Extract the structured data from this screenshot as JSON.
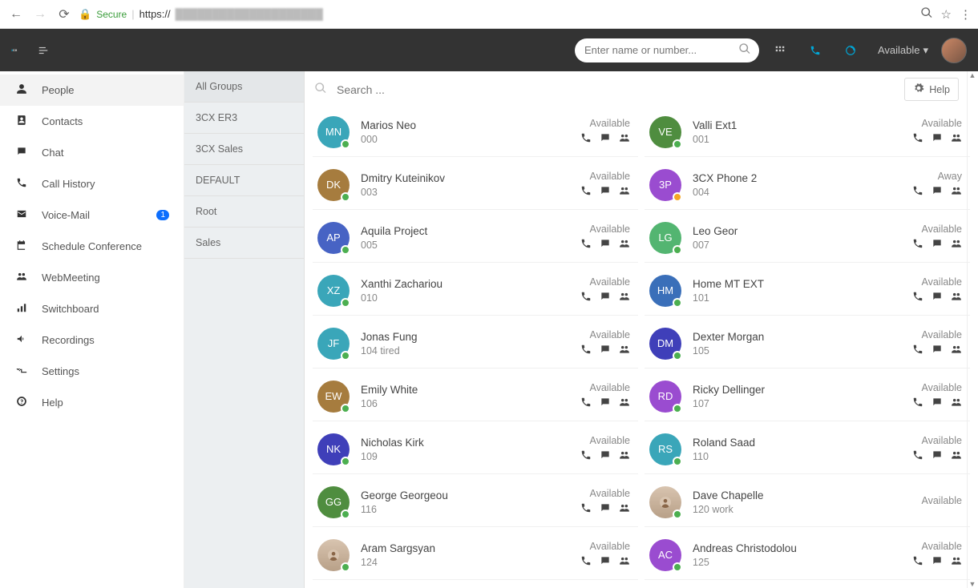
{
  "browser": {
    "secure_label": "Secure",
    "url_prefix": "https://",
    "url_blur": "████████████████████"
  },
  "topbar": {
    "search_placeholder": "Enter name or number...",
    "status_label": "Available"
  },
  "sidebar": [
    {
      "icon": "person",
      "label": "People",
      "active": true
    },
    {
      "icon": "contact",
      "label": "Contacts"
    },
    {
      "icon": "chat",
      "label": "Chat"
    },
    {
      "icon": "phone",
      "label": "Call History"
    },
    {
      "icon": "mail",
      "label": "Voice-Mail",
      "badge": "1"
    },
    {
      "icon": "calendar",
      "label": "Schedule Conference"
    },
    {
      "icon": "group",
      "label": "WebMeeting"
    },
    {
      "icon": "switchboard",
      "label": "Switchboard"
    },
    {
      "icon": "recording",
      "label": "Recordings"
    },
    {
      "icon": "settings",
      "label": "Settings"
    },
    {
      "icon": "help",
      "label": "Help"
    }
  ],
  "groups": [
    {
      "label": "All Groups",
      "active": true
    },
    {
      "label": "3CX ER3"
    },
    {
      "label": "3CX Sales"
    },
    {
      "label": "DEFAULT"
    },
    {
      "label": "Root"
    },
    {
      "label": "Sales"
    }
  ],
  "content": {
    "search_placeholder": "Search ...",
    "help_label": "Help"
  },
  "people": [
    {
      "initials": "MN",
      "color": "#3aa6b9",
      "name": "Marios Neo",
      "ext": "000",
      "status": "Available",
      "presence": "g"
    },
    {
      "initials": "VE",
      "color": "#4f8d3f",
      "name": "Valli Ext1",
      "ext": "001",
      "status": "Available",
      "presence": "g"
    },
    {
      "initials": "DK",
      "color": "#a67c3e",
      "name": "Dmitry Kuteinikov",
      "ext": "003",
      "status": "Available",
      "presence": "g"
    },
    {
      "initials": "3P",
      "color": "#9a4cd0",
      "name": "3CX Phone 2",
      "ext": "004",
      "status": "Away",
      "presence": "y"
    },
    {
      "initials": "AP",
      "color": "#4763c4",
      "name": "Aquila Project",
      "ext": "005",
      "status": "Available",
      "presence": "g"
    },
    {
      "initials": "LG",
      "color": "#53b571",
      "name": "Leo Geor",
      "ext": "007",
      "status": "Available",
      "presence": "g"
    },
    {
      "initials": "XZ",
      "color": "#3aa6b9",
      "name": "Xanthi Zachariou",
      "ext": "010",
      "status": "Available",
      "presence": "g"
    },
    {
      "initials": "HM",
      "color": "#3a6fb9",
      "name": "Home MT EXT",
      "ext": "101",
      "status": "Available",
      "presence": "g"
    },
    {
      "initials": "JF",
      "color": "#3aa6b9",
      "name": "Jonas Fung",
      "ext": "104 tired",
      "status": "Available",
      "presence": "g"
    },
    {
      "initials": "DM",
      "color": "#3f3fb9",
      "name": "Dexter Morgan",
      "ext": "105",
      "status": "Available",
      "presence": "g"
    },
    {
      "initials": "EW",
      "color": "#a67c3e",
      "name": "Emily White",
      "ext": "106",
      "status": "Available",
      "presence": "g"
    },
    {
      "initials": "RD",
      "color": "#9a4cd0",
      "name": "Ricky Dellinger",
      "ext": "107",
      "status": "Available",
      "presence": "g"
    },
    {
      "initials": "NK",
      "color": "#3f3fb9",
      "name": "Nicholas Kirk",
      "ext": "109",
      "status": "Available",
      "presence": "g"
    },
    {
      "initials": "RS",
      "color": "#3aa6b9",
      "name": "Roland Saad",
      "ext": "110",
      "status": "Available",
      "presence": "g"
    },
    {
      "initials": "GG",
      "color": "#4f8d3f",
      "name": "George Georgeou",
      "ext": "116",
      "status": "Available",
      "presence": "g"
    },
    {
      "photo": true,
      "color": "#555",
      "name": "Dave Chapelle",
      "ext": "120 work",
      "status": "Available",
      "presence": "g",
      "no_actions": true
    },
    {
      "photo": true,
      "color": "#555",
      "name": "Aram Sargsyan",
      "ext": "124",
      "status": "Available",
      "presence": "g"
    },
    {
      "initials": "AC",
      "color": "#9a4cd0",
      "name": "Andreas Christodolou",
      "ext": "125",
      "status": "Available",
      "presence": "g"
    }
  ]
}
